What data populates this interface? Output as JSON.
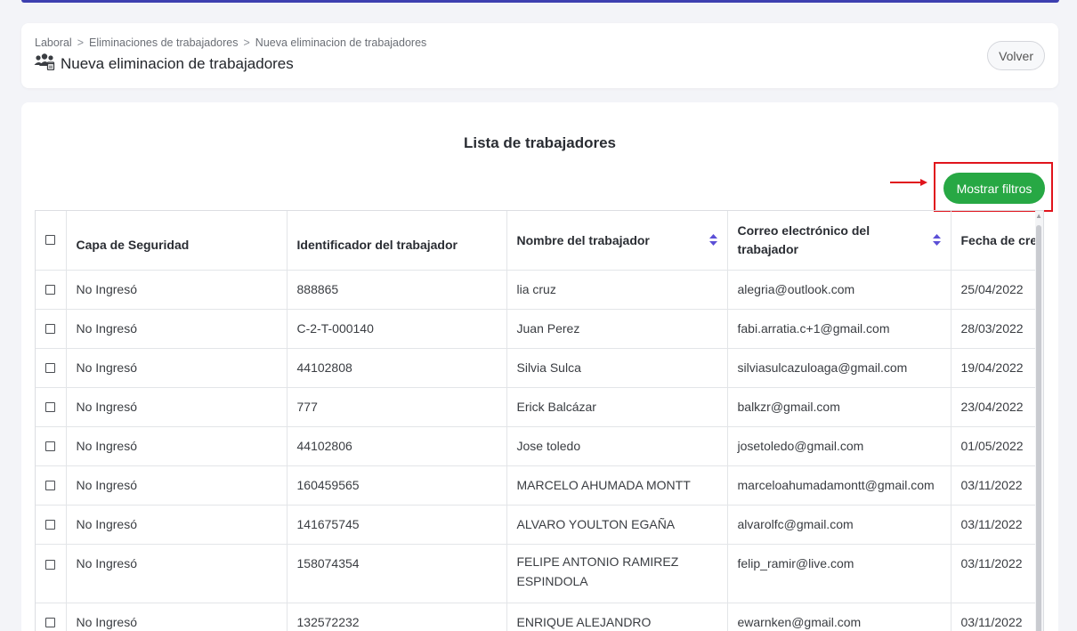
{
  "breadcrumb": {
    "items": [
      "Laboral",
      "Eliminaciones de trabajadores",
      "Nueva eliminacion de trabajadores"
    ],
    "separator": ">"
  },
  "page": {
    "title": "Nueva eliminacion de trabajadores",
    "back_label": "Volver"
  },
  "list": {
    "title": "Lista de trabajadores",
    "filter_button": "Mostrar filtros"
  },
  "colors": {
    "accent": "#3d3fb0",
    "button_green": "#27a844",
    "highlight_red": "#e0141c",
    "sort_icon": "#5b4fd6"
  },
  "table": {
    "columns": [
      "Capa de Seguridad",
      "Identificador del trabajador",
      "Nombre del trabajador",
      "Correo electrónico del trabajador",
      "Fecha de cre"
    ],
    "rows": [
      {
        "capa": "No Ingresó",
        "id": "888865",
        "nombre": "lia cruz",
        "correo": "alegria@outlook.com",
        "fecha": "25/04/2022"
      },
      {
        "capa": "No Ingresó",
        "id": "C-2-T-000140",
        "nombre": "Juan Perez",
        "correo": "fabi.arratia.c+1@gmail.com",
        "fecha": "28/03/2022"
      },
      {
        "capa": "No Ingresó",
        "id": "44102808",
        "nombre": "Silvia Sulca",
        "correo": "silviasulcazuloaga@gmail.com",
        "fecha": "19/04/2022"
      },
      {
        "capa": "No Ingresó",
        "id": "777",
        "nombre": "Erick Balcázar",
        "correo": "balkzr@gmail.com",
        "fecha": "23/04/2022"
      },
      {
        "capa": "No Ingresó",
        "id": "44102806",
        "nombre": "Jose toledo",
        "correo": "josetoledo@gmail.com",
        "fecha": "01/05/2022"
      },
      {
        "capa": "No Ingresó",
        "id": "160459565",
        "nombre": "MARCELO AHUMADA MONTT",
        "correo": "marceloahumadamontt@gmail.com",
        "fecha": "03/11/2022"
      },
      {
        "capa": "No Ingresó",
        "id": "141675745",
        "nombre": "ALVARO YOULTON EGAÑA",
        "correo": "alvarolfc@gmail.com",
        "fecha": "03/11/2022"
      },
      {
        "capa": "No Ingresó",
        "id": "158074354",
        "nombre": "FELIPE ANTONIO RAMIREZ ESPINDOLA",
        "correo": "felip_ramir@live.com",
        "fecha": "03/11/2022"
      },
      {
        "capa": "No Ingresó",
        "id": "132572232",
        "nombre": "ENRIQUE ALEJANDRO",
        "correo": "ewarnken@gmail.com",
        "fecha": "03/11/2022"
      }
    ]
  }
}
